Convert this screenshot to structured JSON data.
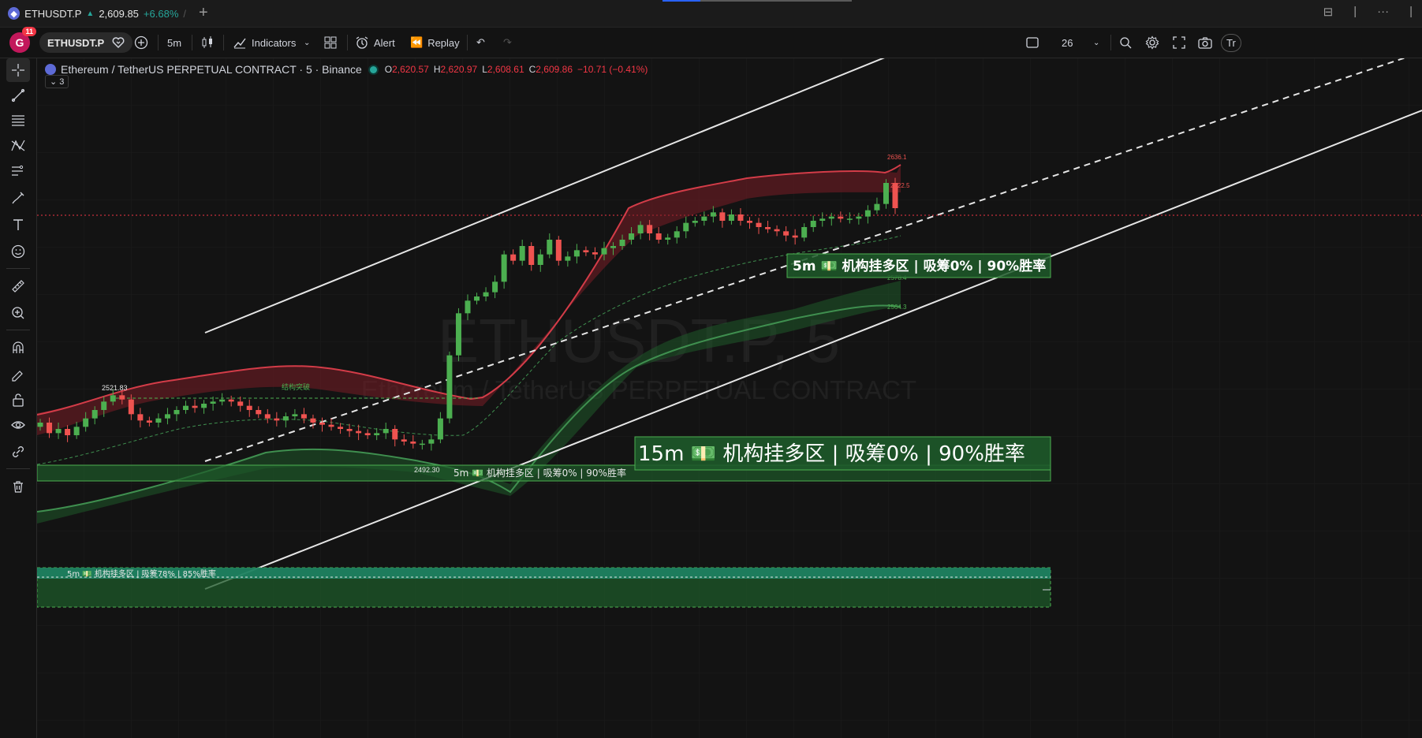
{
  "tab": {
    "symbol": "ETHUSDT.P",
    "price": "2,609.85",
    "change": "+6.68%",
    "separator": "/"
  },
  "toolbar": {
    "notification_count": "11",
    "avatar_letter": "G",
    "symbol": "ETHUSDT.P",
    "interval": "5m",
    "indicators_label": "Indicators",
    "alert_label": "Alert",
    "replay_label": "Replay",
    "layout_count": "26",
    "trade_label": "Tr"
  },
  "legend": {
    "title": "Ethereum / TetherUS PERPETUAL CONTRACT · 5 · Binance",
    "open_key": "O",
    "open": "2,620.57",
    "high_key": "H",
    "high": "2,620.97",
    "low_key": "L",
    "low": "2,608.61",
    "close_key": "C",
    "close": "2,609.86",
    "change": "−10.71 (−0.41%)",
    "collapse_count": "3"
  },
  "watermark": {
    "symbol": "ETHUSDT.P, 5",
    "description": "Ethereum / TetherUS PERPETUAL CONTRACT"
  },
  "annotations": {
    "high_label": "2521.83",
    "low_label": "2492.30",
    "structure_break": "结构突破",
    "upper_band_label": "2636.1",
    "price_label": "2622.5",
    "mid_band_label": "2578.4",
    "lower_band_label": "2564.3",
    "zone_5m_top": "5m 💵 机构挂多区 | 吸筹0% | 90%胜率",
    "zone_15m": "15m 💵 机构挂多区 | 吸筹0% | 90%胜率",
    "zone_5m_mid": "5m 💵 机构挂多区 | 吸筹0% | 90%胜率",
    "zone_5m_bottom": "5m 💵 机构挂多区 | 吸筹78% | 85%胜率"
  },
  "colors": {
    "up": "#4caf50",
    "down": "#ef5350",
    "zone_fill": "#1e5a2a",
    "zone_border": "#4caf50",
    "teal_zone": "#1e8a6a",
    "upper_band": "#8b2c33",
    "lower_band": "#2e6b3a"
  },
  "chart_data": {
    "type": "candlestick",
    "symbol": "ETHUSDT.P",
    "interval": "5",
    "last_close": 2609.86,
    "closes": [
      2508,
      2503,
      2505,
      2502,
      2506,
      2510,
      2514,
      2518,
      2521,
      2519,
      2512,
      2509,
      2508,
      2510,
      2512,
      2514,
      2516,
      2515,
      2517,
      2518,
      2519,
      2518,
      2516,
      2514,
      2512,
      2510,
      2509,
      2511,
      2512,
      2510,
      2508,
      2507,
      2506,
      2505,
      2504,
      2503,
      2502,
      2503,
      2505,
      2500,
      2499,
      2498,
      2498,
      2500,
      2510,
      2540,
      2560,
      2566,
      2568,
      2570,
      2575,
      2588,
      2585,
      2592,
      2583,
      2588,
      2595,
      2585,
      2587,
      2590,
      2589,
      2588,
      2591,
      2592,
      2595,
      2598,
      2602,
      2598,
      2595,
      2596,
      2599,
      2603,
      2604,
      2606,
      2608,
      2604,
      2607,
      2604,
      2603,
      2601,
      2600,
      2599,
      2597,
      2596,
      2601,
      2604,
      2605,
      2606,
      2605,
      2605,
      2606,
      2609,
      2612,
      2622,
      2610
    ]
  }
}
